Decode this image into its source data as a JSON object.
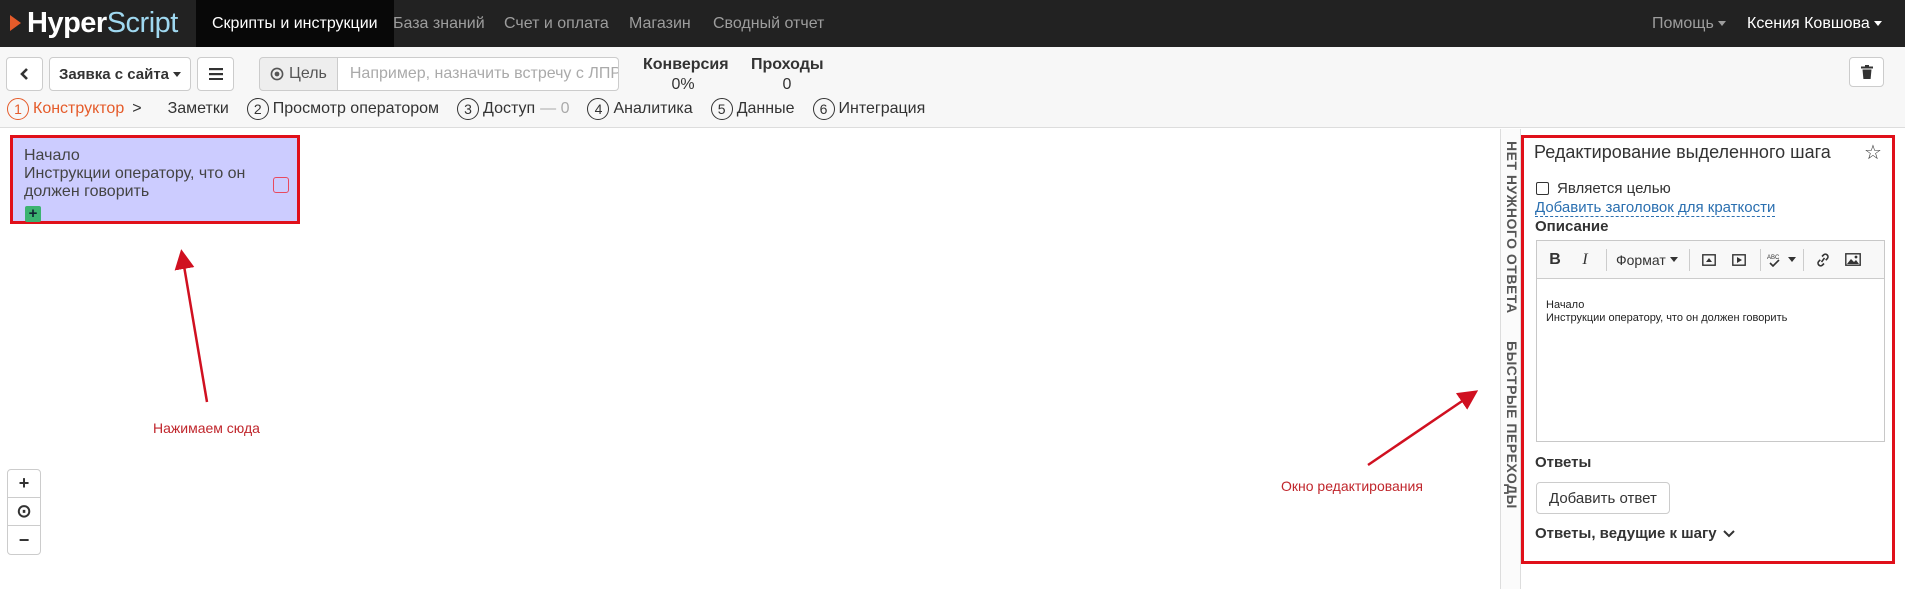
{
  "navbar": {
    "logo": {
      "part1": "Hyper",
      "part2": "Script"
    },
    "items": [
      {
        "label": "Скрипты и инструкции",
        "active": true
      },
      {
        "label": "База знаний"
      },
      {
        "label": "Счет и оплата"
      },
      {
        "label": "Магазин"
      },
      {
        "label": "Сводный отчет"
      }
    ],
    "help": "Помощь",
    "user": "Ксения Ковшова"
  },
  "toolbar": {
    "script_name": "Заявка с сайта",
    "goal_label": "Цель",
    "goal_placeholder": "Например, назначить встречу с ЛПР",
    "stats": [
      {
        "label": "Конверсия",
        "value": "0%"
      },
      {
        "label": "Проходы",
        "value": "0"
      }
    ]
  },
  "steps": [
    {
      "num": "1",
      "label": "Конструктор",
      "active": true
    },
    {
      "label": "Заметки"
    },
    {
      "num": "2",
      "label": "Просмотр оператором"
    },
    {
      "num": "3",
      "label": "Доступ",
      "extra": "— 0"
    },
    {
      "num": "4",
      "label": "Аналитика"
    },
    {
      "num": "5",
      "label": "Данные"
    },
    {
      "num": "6",
      "label": "Интеграция"
    }
  ],
  "node": {
    "title": "Начало",
    "text": "Инструкции оператору, что он должен говорить"
  },
  "annotations": {
    "click_here": "Нажимаем сюда",
    "edit_window": "Окно редактирования"
  },
  "zoom": {
    "plus": "+",
    "reset": "⊙",
    "minus": "−"
  },
  "vtabs": {
    "no_answer": "НЕТ НУЖНОГО ОТВЕТА",
    "quick_jumps": "БЫСТРЫЕ ПЕРЕХОДЫ"
  },
  "panel": {
    "title": "Редактирование выделенного шага",
    "is_goal": "Является целью",
    "add_header": "Добавить заголовок для краткости",
    "description_label": "Описание",
    "editor": {
      "format_label": "Формат",
      "content_line1": "Начало",
      "content_line2": "Инструкции оператору, что он должен говорить"
    },
    "answers_label": "Ответы",
    "add_answer": "Добавить ответ",
    "incoming_answers": "Ответы, ведущие к шагу"
  },
  "colors": {
    "navbar_bg": "#222222",
    "accent": "#e55b2a",
    "highlight_border": "#e0101a",
    "node_bg": "#ccccff",
    "annotation": "#c0262c",
    "link": "#2a6fb0"
  }
}
